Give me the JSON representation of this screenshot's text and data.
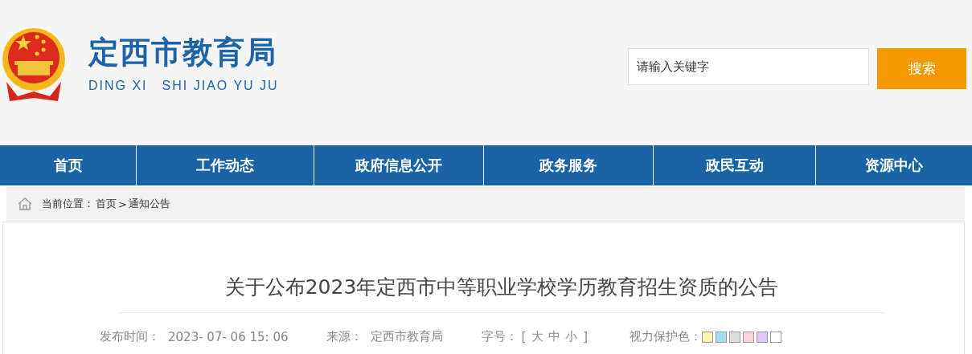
{
  "header": {
    "site_name": "定西市教育局",
    "site_pinyin": "DING XI　SHI JIAO YU JU",
    "search": {
      "placeholder": "请输入关键字",
      "button": "搜索"
    }
  },
  "nav": [
    {
      "label": "首页"
    },
    {
      "label": "工作动态"
    },
    {
      "label": "政府信息公开"
    },
    {
      "label": "政务服务"
    },
    {
      "label": "政民互动"
    },
    {
      "label": "资源中心"
    }
  ],
  "breadcrumb": {
    "prefix": "当前位置：",
    "items": [
      "首页",
      "通知公告"
    ],
    "separator": ">"
  },
  "article": {
    "title": "关于公布2023年定西市中等职业学校学历教育招生资质的公告",
    "meta": {
      "date_label": "发布时间：",
      "date": "2023- 07- 06 15: 06",
      "source_label": "来源：",
      "source": "定西市教育局",
      "font_label": "字号：",
      "open_bracket": "[",
      "font_sizes": [
        "大",
        "中",
        "小"
      ],
      "close_bracket": "]",
      "color_label": "视力保护色：",
      "colors": [
        {
          "color": "#faf7b5"
        },
        {
          "color": "#a6dcf4"
        },
        {
          "color": "#dddddd"
        },
        {
          "color": "#f8d4dc"
        },
        {
          "color": "#e3c8f5"
        },
        {
          "color": "#ffffff"
        }
      ]
    }
  }
}
